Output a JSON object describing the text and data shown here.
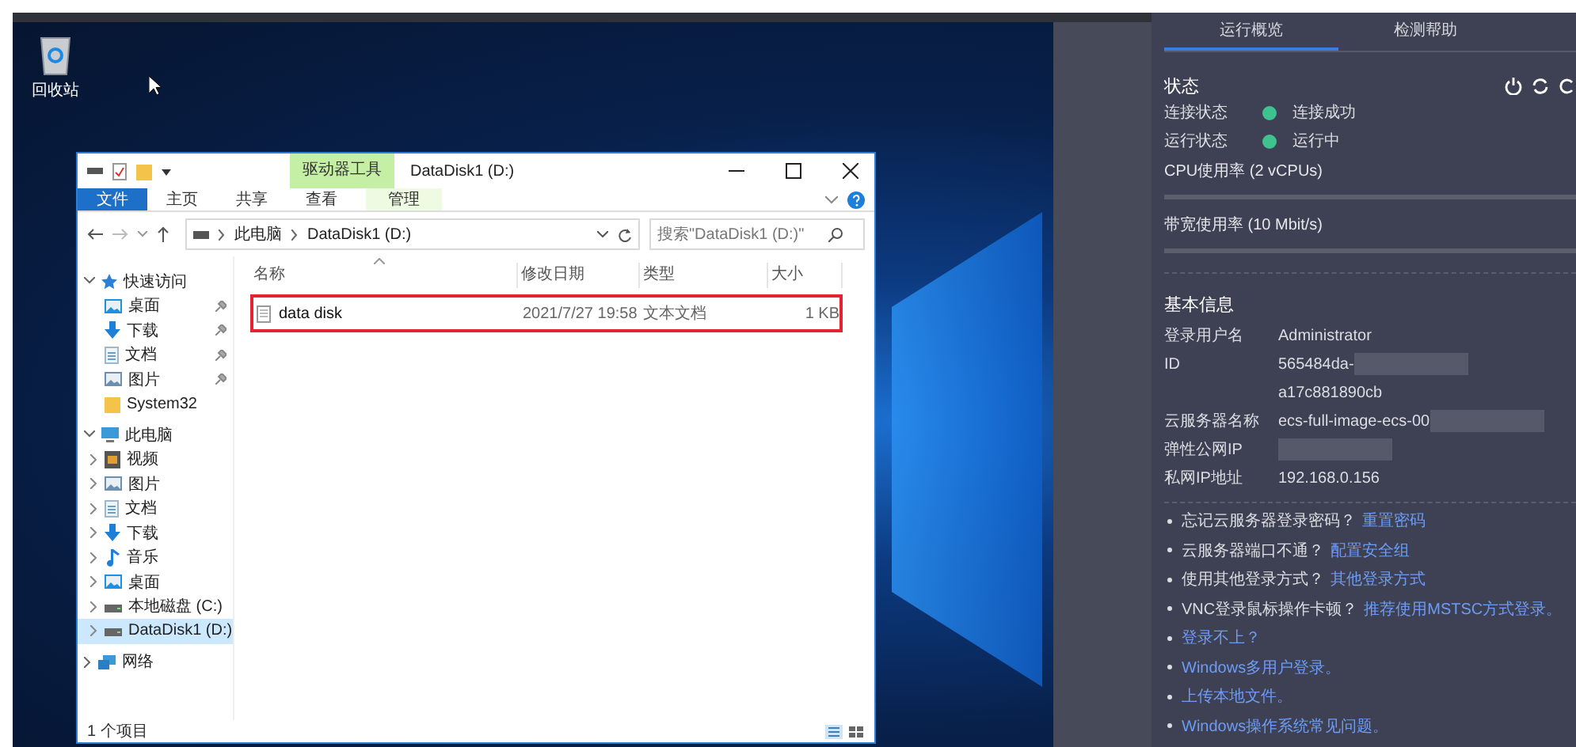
{
  "desktop": {
    "recycle_bin_label": "回收站"
  },
  "explorer": {
    "context_group": "驱动器工具",
    "title": "DataDisk1 (D:)",
    "ribbon_tabs": [
      {
        "label": "文件",
        "kind": "file"
      },
      {
        "label": "主页",
        "kind": "normal"
      },
      {
        "label": "共享",
        "kind": "normal"
      },
      {
        "label": "查看",
        "kind": "normal"
      },
      {
        "label": "管理",
        "kind": "context"
      }
    ],
    "breadcrumbs": [
      "此电脑",
      "DataDisk1 (D:)"
    ],
    "search": {
      "placeholder": "搜索\"DataDisk1 (D:)\""
    },
    "columns": [
      "名称",
      "修改日期",
      "类型",
      "大小"
    ],
    "rows": [
      {
        "name": "data disk",
        "date": "2021/7/27 19:58",
        "type": "文本文档",
        "size": "1 KB",
        "highlighted": true
      }
    ],
    "nav": [
      {
        "label": "快速访问",
        "kind": "star",
        "expanded": true,
        "selected": false,
        "children": [
          {
            "label": "桌面",
            "kind": "desktop",
            "pinned": true,
            "selected": false
          },
          {
            "label": "下载",
            "kind": "download",
            "pinned": true,
            "selected": false
          },
          {
            "label": "文档",
            "kind": "doc",
            "pinned": true,
            "selected": false
          },
          {
            "label": "图片",
            "kind": "picture",
            "pinned": true,
            "selected": false
          },
          {
            "label": "System32",
            "kind": "folder",
            "pinned": false,
            "selected": false
          }
        ]
      },
      {
        "label": "此电脑",
        "kind": "pc",
        "expanded": true,
        "selected": false,
        "children": [
          {
            "label": "视频",
            "kind": "video",
            "expandable": true,
            "selected": false
          },
          {
            "label": "图片",
            "kind": "picture",
            "expandable": true,
            "selected": false
          },
          {
            "label": "文档",
            "kind": "doc",
            "expandable": true,
            "selected": false
          },
          {
            "label": "下载",
            "kind": "download",
            "expandable": true,
            "selected": false
          },
          {
            "label": "音乐",
            "kind": "music",
            "expandable": true,
            "selected": false
          },
          {
            "label": "桌面",
            "kind": "desktop",
            "expandable": true,
            "selected": false
          },
          {
            "label": "本地磁盘 (C:)",
            "kind": "drive",
            "expandable": true,
            "selected": false
          },
          {
            "label": "DataDisk1 (D:)",
            "kind": "drive",
            "expandable": true,
            "selected": true
          }
        ]
      },
      {
        "label": "网络",
        "kind": "network",
        "expanded": false,
        "selected": false
      }
    ],
    "status_bar": "1 个项目"
  },
  "panel": {
    "tabs": [
      {
        "label": "运行概览",
        "selected": true
      },
      {
        "label": "检测帮助",
        "selected": false
      }
    ],
    "status_title": "状态",
    "status_rows": [
      {
        "label": "连接状态",
        "value": "连接成功",
        "color": "#3ec28f"
      },
      {
        "label": "运行状态",
        "value": "运行中",
        "color": "#3ec28f"
      }
    ],
    "meters": [
      "CPU使用率 (2 vCPUs)",
      "带宽使用率 (10 Mbit/s)"
    ],
    "info_title": "基本信息",
    "info": [
      {
        "label": "登录用户名",
        "value": "Administrator",
        "redacted": false
      },
      {
        "label": "ID",
        "value": "565484da-",
        "redacted": true,
        "value_2": "a17c881890cb"
      },
      {
        "label": "云服务器名称",
        "value": "ecs-full-image-ecs-00",
        "redacted": true
      },
      {
        "label": "弹性公网IP",
        "redacted": true
      },
      {
        "label": "私网IP地址",
        "value": "192.168.0.156",
        "redacted": false
      }
    ],
    "help": [
      {
        "question": "忘记云服务器登录密码？",
        "link": "重置密码"
      },
      {
        "question": "云服务器端口不通？",
        "link": "配置安全组"
      },
      {
        "question": "使用其他登录方式？",
        "link": "其他登录方式"
      },
      {
        "question": "VNC登录鼠标操作卡顿？",
        "link": "推荐使用MSTSC方式登录。"
      },
      {
        "link": "登录不上？"
      },
      {
        "link": "Windows多用户登录。"
      },
      {
        "link": "上传本地文件。"
      },
      {
        "link": "Windows操作系统常见问题。"
      }
    ]
  }
}
